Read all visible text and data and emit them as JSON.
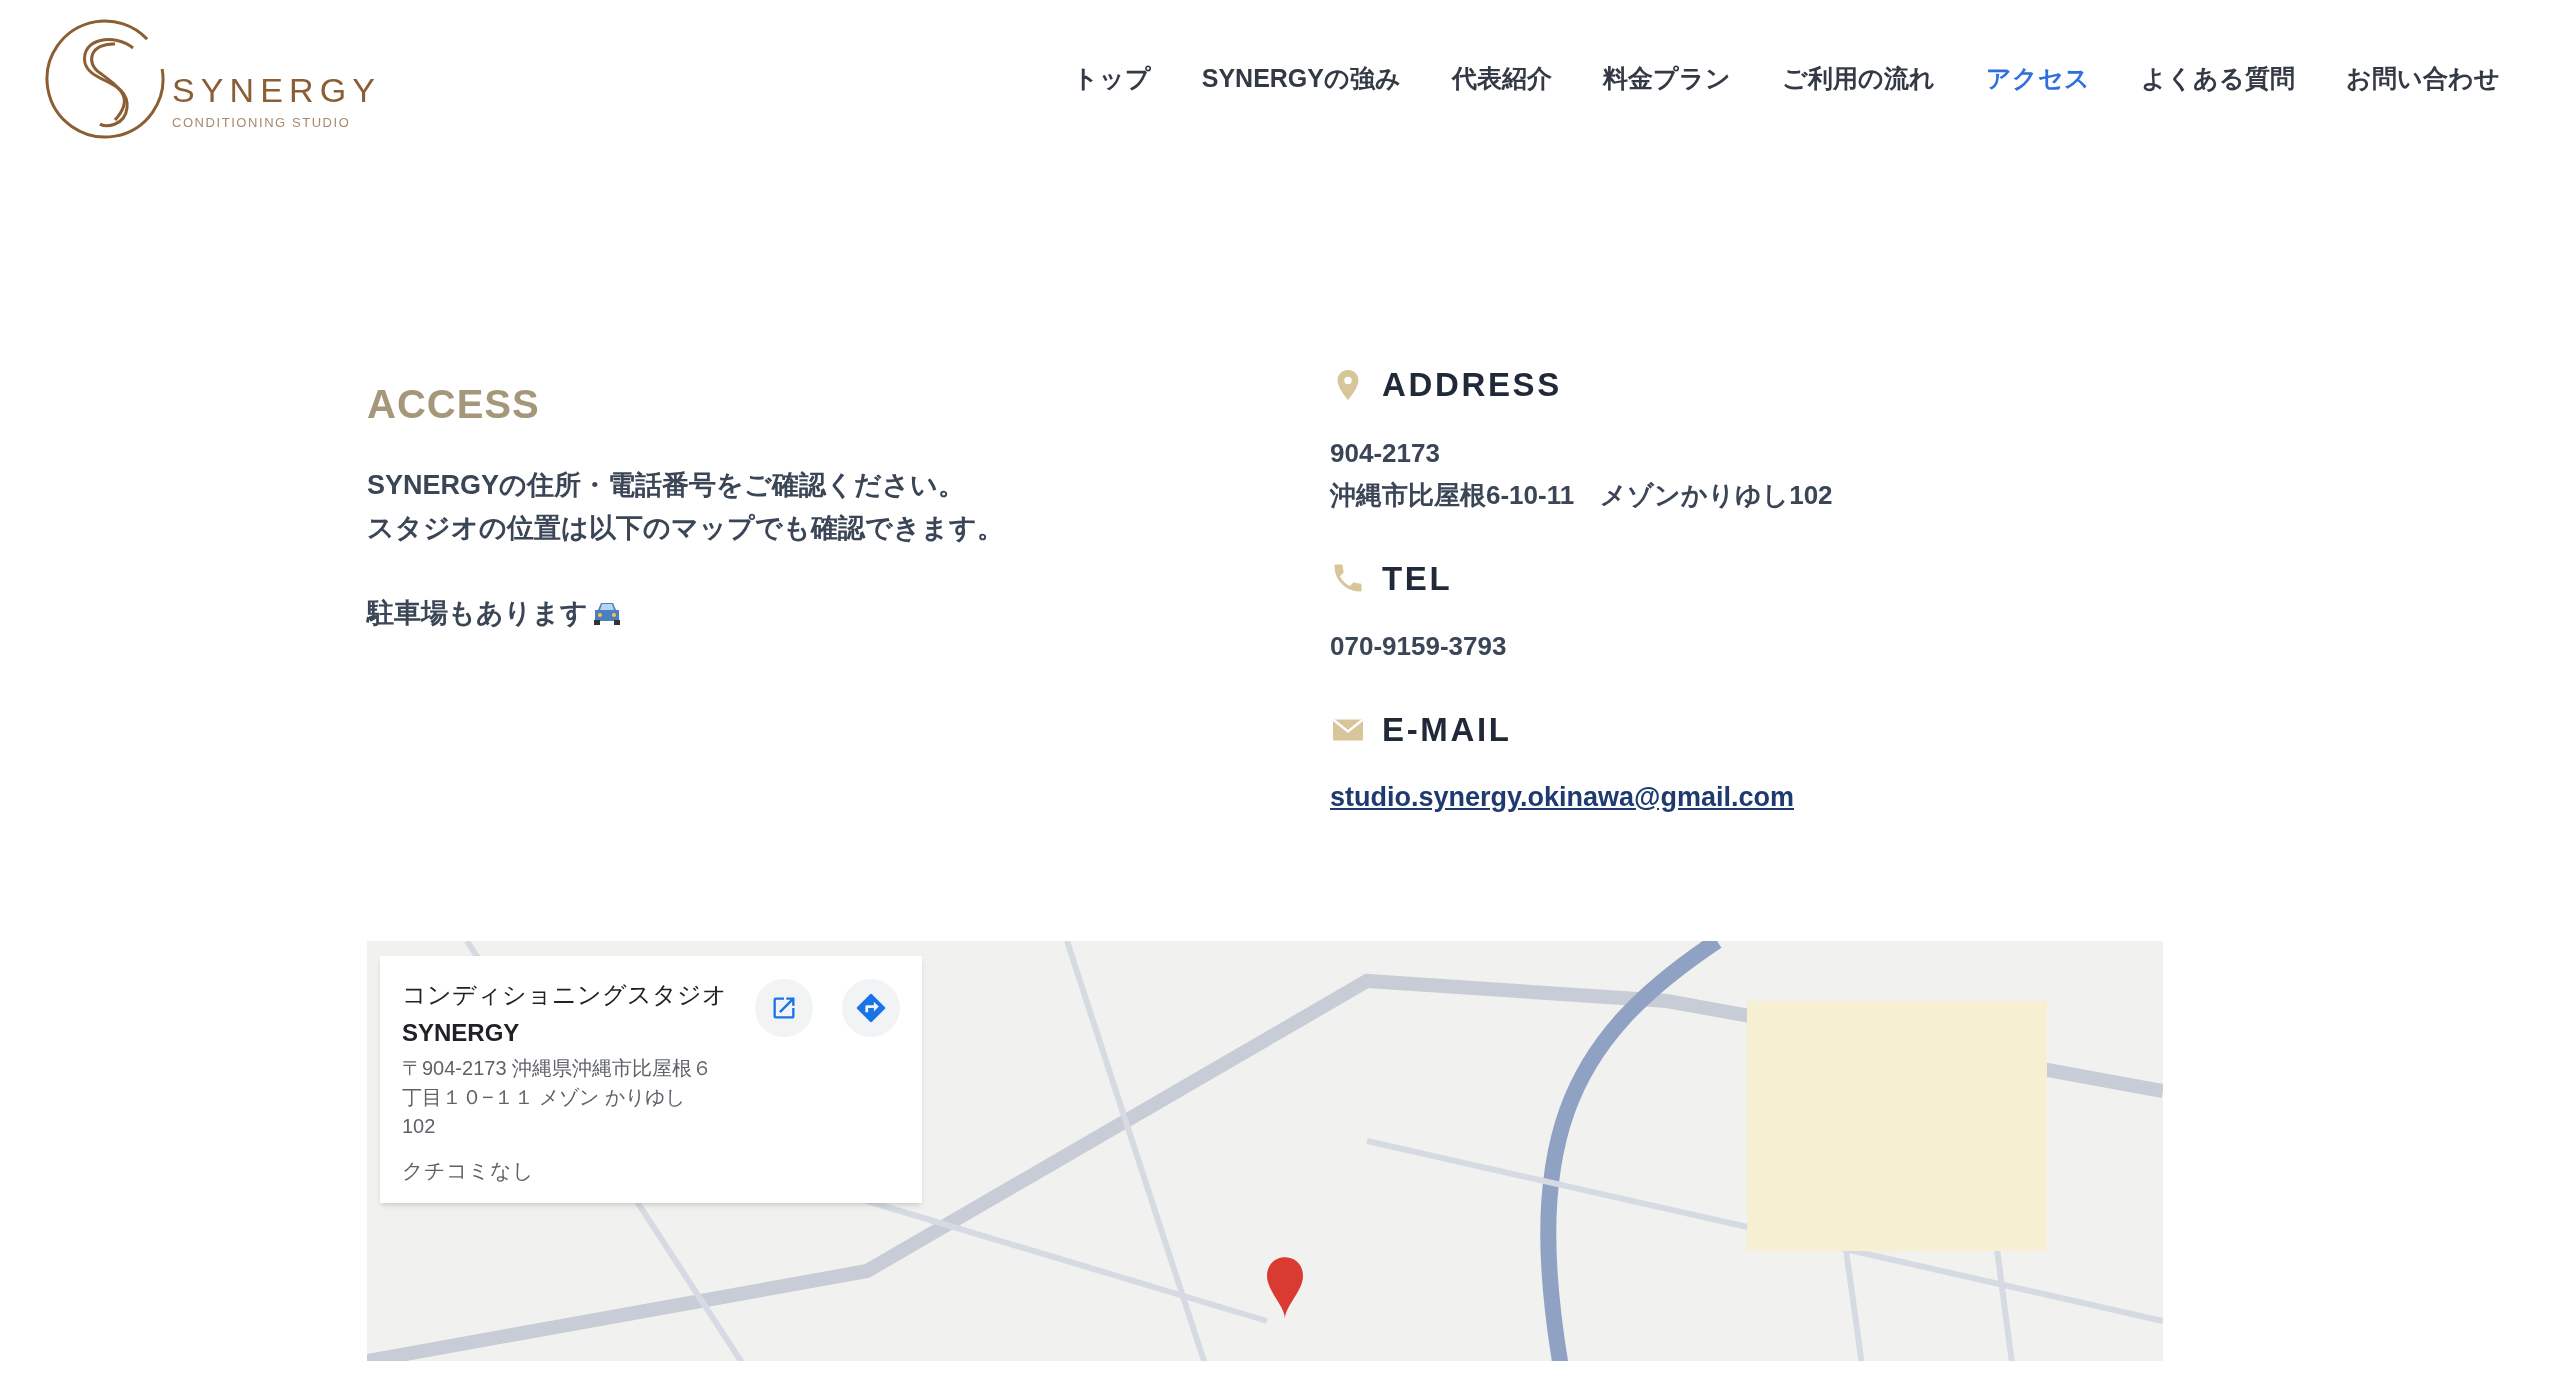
{
  "logo": {
    "name": "SYNERGY",
    "tagline": "CONDITIONING STUDIO"
  },
  "nav": [
    {
      "label": "トップ",
      "selected": false
    },
    {
      "label": "SYNERGYの強み",
      "selected": false
    },
    {
      "label": "代表紹介",
      "selected": false
    },
    {
      "label": "料金プラン",
      "selected": false
    },
    {
      "label": "ご利用の流れ",
      "selected": false
    },
    {
      "label": "アクセス",
      "selected": true
    },
    {
      "label": "よくある質問",
      "selected": false
    },
    {
      "label": "お問い合わせ",
      "selected": false
    }
  ],
  "access": {
    "title": "ACCESS",
    "lines": [
      "SYNERGYの住所・電話番号をご確認ください。",
      "スタジオの位置は以下のマップでも確認できます。"
    ],
    "parking": "駐車場もあります"
  },
  "contacts": [
    {
      "kind": "address",
      "heading": "ADDRESS",
      "lines": [
        "904-2173",
        "沖縄市比屋根6-10-11　メゾンかりゆし102"
      ]
    },
    {
      "kind": "tel",
      "heading": "TEL",
      "lines": [
        "070-9159-3793"
      ]
    },
    {
      "kind": "email",
      "heading": "E-MAIL",
      "link": "studio.synergy.okinawa@gmail.com"
    }
  ],
  "map_card": {
    "name_lines": [
      "コンディショニングスタジオ",
      "SYNERGY"
    ],
    "address": "〒904-2173 沖縄県沖縄市比屋根６丁目１０−１１ メゾン かりゆし 102",
    "reviews": "クチコミなし"
  }
}
